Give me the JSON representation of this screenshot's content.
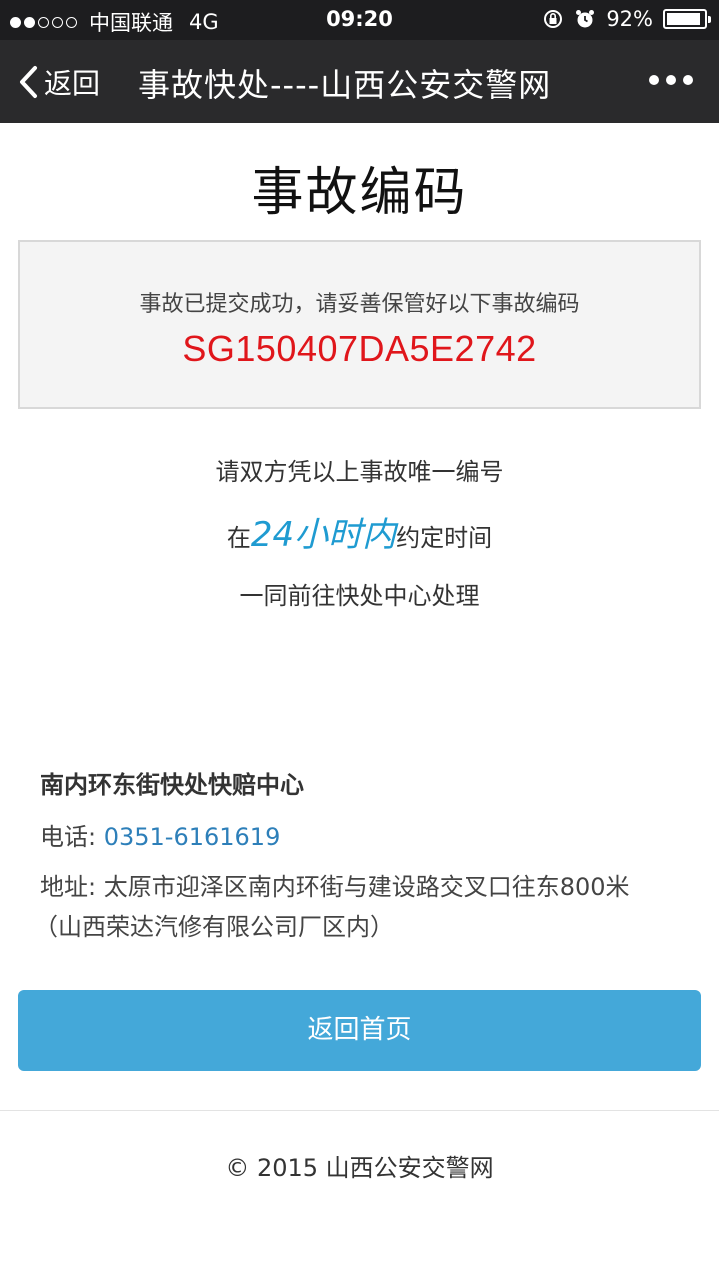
{
  "status_bar": {
    "carrier": "中国联通",
    "network": "4G",
    "time": "09:20",
    "battery": "92%",
    "battery_level": 0.92,
    "signal_bars_filled": 2,
    "signal_bars_total": 5
  },
  "nav": {
    "back_label": "返回",
    "title": "事故快处----山西公安交警网"
  },
  "main": {
    "title": "事故编码",
    "submit_message": "事故已提交成功，请妥善保管好以下事故编码",
    "accident_code": "SG150407DA5E2742",
    "instructions": {
      "line1": "请双方凭以上事故唯一编号",
      "line2_prefix": "在",
      "line2_highlight": "24小时内",
      "line2_suffix": "约定时间",
      "line3": "一同前往快处中心处理"
    }
  },
  "center": {
    "name": "南内环东街快处快赔中心",
    "phone_label": "电话: ",
    "phone": "0351-6161619",
    "address_label": "地址: ",
    "address": "太原市迎泽区南内环街与建设路交叉口往东800米",
    "address_note": "（山西荣达汽修有限公司厂区内）"
  },
  "actions": {
    "home_button": "返回首页"
  },
  "footer": {
    "copyright": "© 2015 山西公安交警网"
  },
  "colors": {
    "code": "#e0161b",
    "highlight": "#1f9bd1",
    "phone": "#2d7fb9",
    "button": "#44a8d9",
    "navbar": "#2a2a2c"
  }
}
